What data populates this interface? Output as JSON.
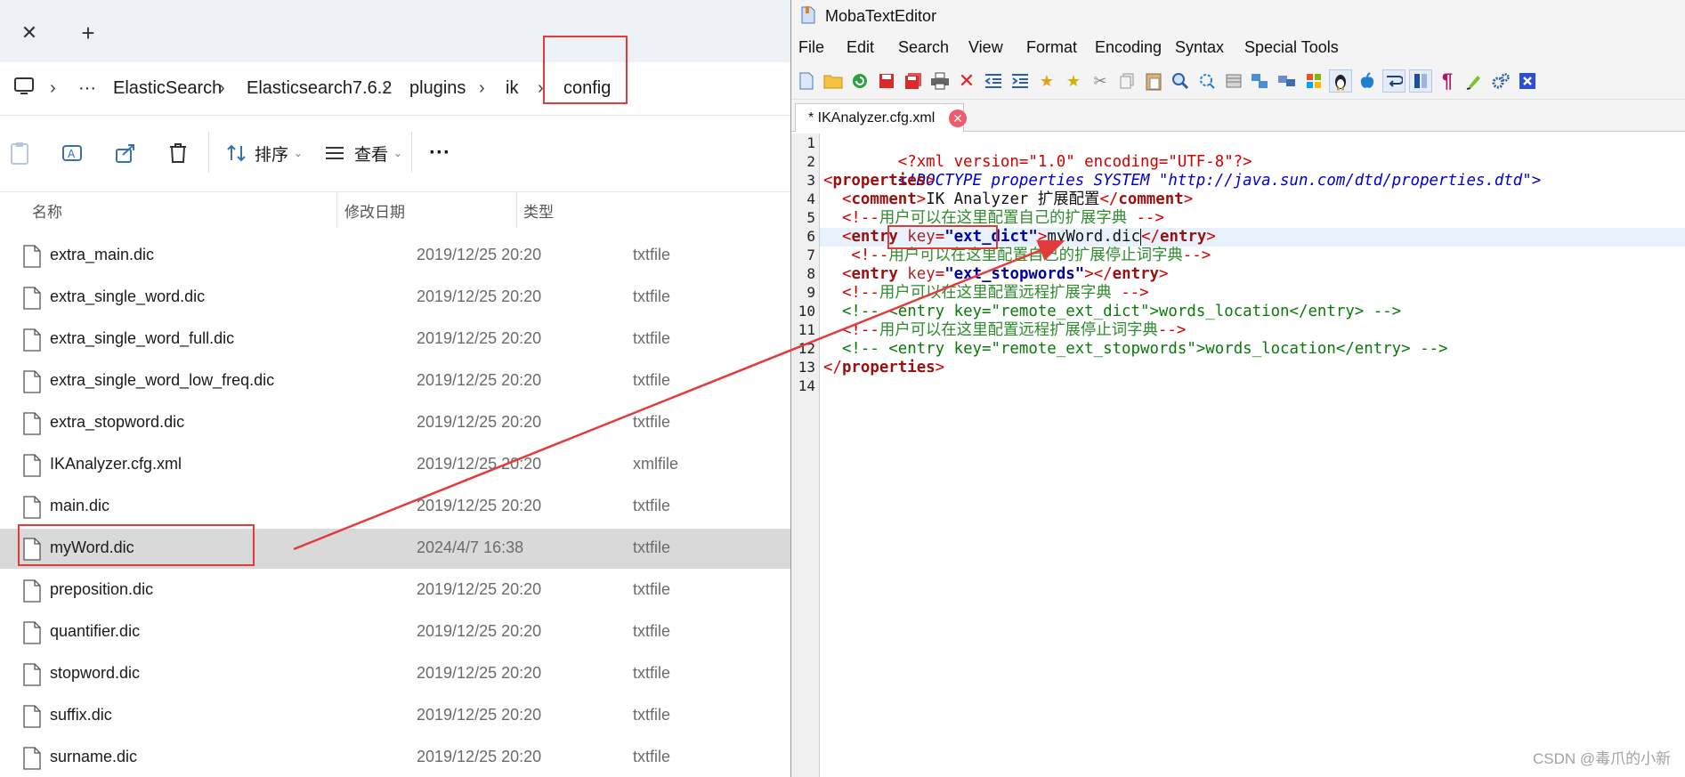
{
  "explorer": {
    "breadcrumb": [
      "···",
      "ElasticSearch",
      "Elasticsearch7.6.2",
      "plugins",
      "ik",
      "config"
    ],
    "commands": {
      "sort_label": "排序",
      "view_label": "查看",
      "more_label": "···"
    },
    "columns": {
      "name": "名称",
      "date": "修改日期",
      "type": "类型"
    },
    "files": [
      {
        "name": "extra_main.dic",
        "date": "2019/12/25 20:20",
        "type": "txtfile"
      },
      {
        "name": "extra_single_word.dic",
        "date": "2019/12/25 20:20",
        "type": "txtfile"
      },
      {
        "name": "extra_single_word_full.dic",
        "date": "2019/12/25 20:20",
        "type": "txtfile"
      },
      {
        "name": "extra_single_word_low_freq.dic",
        "date": "2019/12/25 20:20",
        "type": "txtfile"
      },
      {
        "name": "extra_stopword.dic",
        "date": "2019/12/25 20:20",
        "type": "txtfile"
      },
      {
        "name": "IKAnalyzer.cfg.xml",
        "date": "2019/12/25 20:20",
        "type": "xmlfile"
      },
      {
        "name": "main.dic",
        "date": "2019/12/25 20:20",
        "type": "txtfile"
      },
      {
        "name": "myWord.dic",
        "date": "2024/4/7 16:38",
        "type": "txtfile",
        "selected": true
      },
      {
        "name": "preposition.dic",
        "date": "2019/12/25 20:20",
        "type": "txtfile"
      },
      {
        "name": "quantifier.dic",
        "date": "2019/12/25 20:20",
        "type": "txtfile"
      },
      {
        "name": "stopword.dic",
        "date": "2019/12/25 20:20",
        "type": "txtfile"
      },
      {
        "name": "suffix.dic",
        "date": "2019/12/25 20:20",
        "type": "txtfile"
      },
      {
        "name": "surname.dic",
        "date": "2019/12/25 20:20",
        "type": "txtfile"
      }
    ]
  },
  "editor": {
    "title": "MobaTextEditor",
    "menu": [
      "File",
      "Edit",
      "Search",
      "View",
      "Format",
      "Encoding",
      "Syntax",
      "Special Tools"
    ],
    "tab_label": "* IKAnalyzer.cfg.xml",
    "line_numbers": [
      "1",
      "2",
      "3",
      "4",
      "5",
      "6",
      "7",
      "8",
      "9",
      "10",
      "11",
      "12",
      "13",
      "14"
    ],
    "code": {
      "l1": "<?xml version=\"1.0\" encoding=\"UTF-8\"?>",
      "l2": "<!DOCTYPE properties SYSTEM \"http://java.sun.com/dtd/properties.dtd\">",
      "l3_tag": "properties",
      "l4_tag": "comment",
      "l4_text": "IK Analyzer 扩展配置",
      "l5_open": "<!--",
      "l5_text": "用户可以在这里配置自己的扩展字典",
      "l5_close": " -->",
      "l6_tag": "entry",
      "l6_attr": "key",
      "l6_val": "\"ext_dict\"",
      "l6_text": "myWord.dic",
      "l7_open": "<!--",
      "l7_text": "用户可以在这里配置自己的扩展停止词字典",
      "l7_close": "-->",
      "l8_tag": "entry",
      "l8_attr": "key",
      "l8_val": "\"ext_stopwords\"",
      "l9_open": "<!--",
      "l9_text": "用户可以在这里配置远程扩展字典",
      "l9_close": " -->",
      "l10": "<!-- <entry key=\"remote_ext_dict\">words_location</entry> -->",
      "l11_open": "<!--",
      "l11_text": "用户可以在这里配置远程扩展停止词字典",
      "l11_close": "-->",
      "l12": "<!-- <entry key=\"remote_ext_stopwords\">words_location</entry> -->",
      "l13_tag": "properties"
    }
  },
  "watermark": "CSDN @毒爪的小新",
  "colors": {
    "annotation_red": "#e23b3b",
    "selected_row": "#d9d9d9",
    "current_line": "#e8f2fc"
  }
}
